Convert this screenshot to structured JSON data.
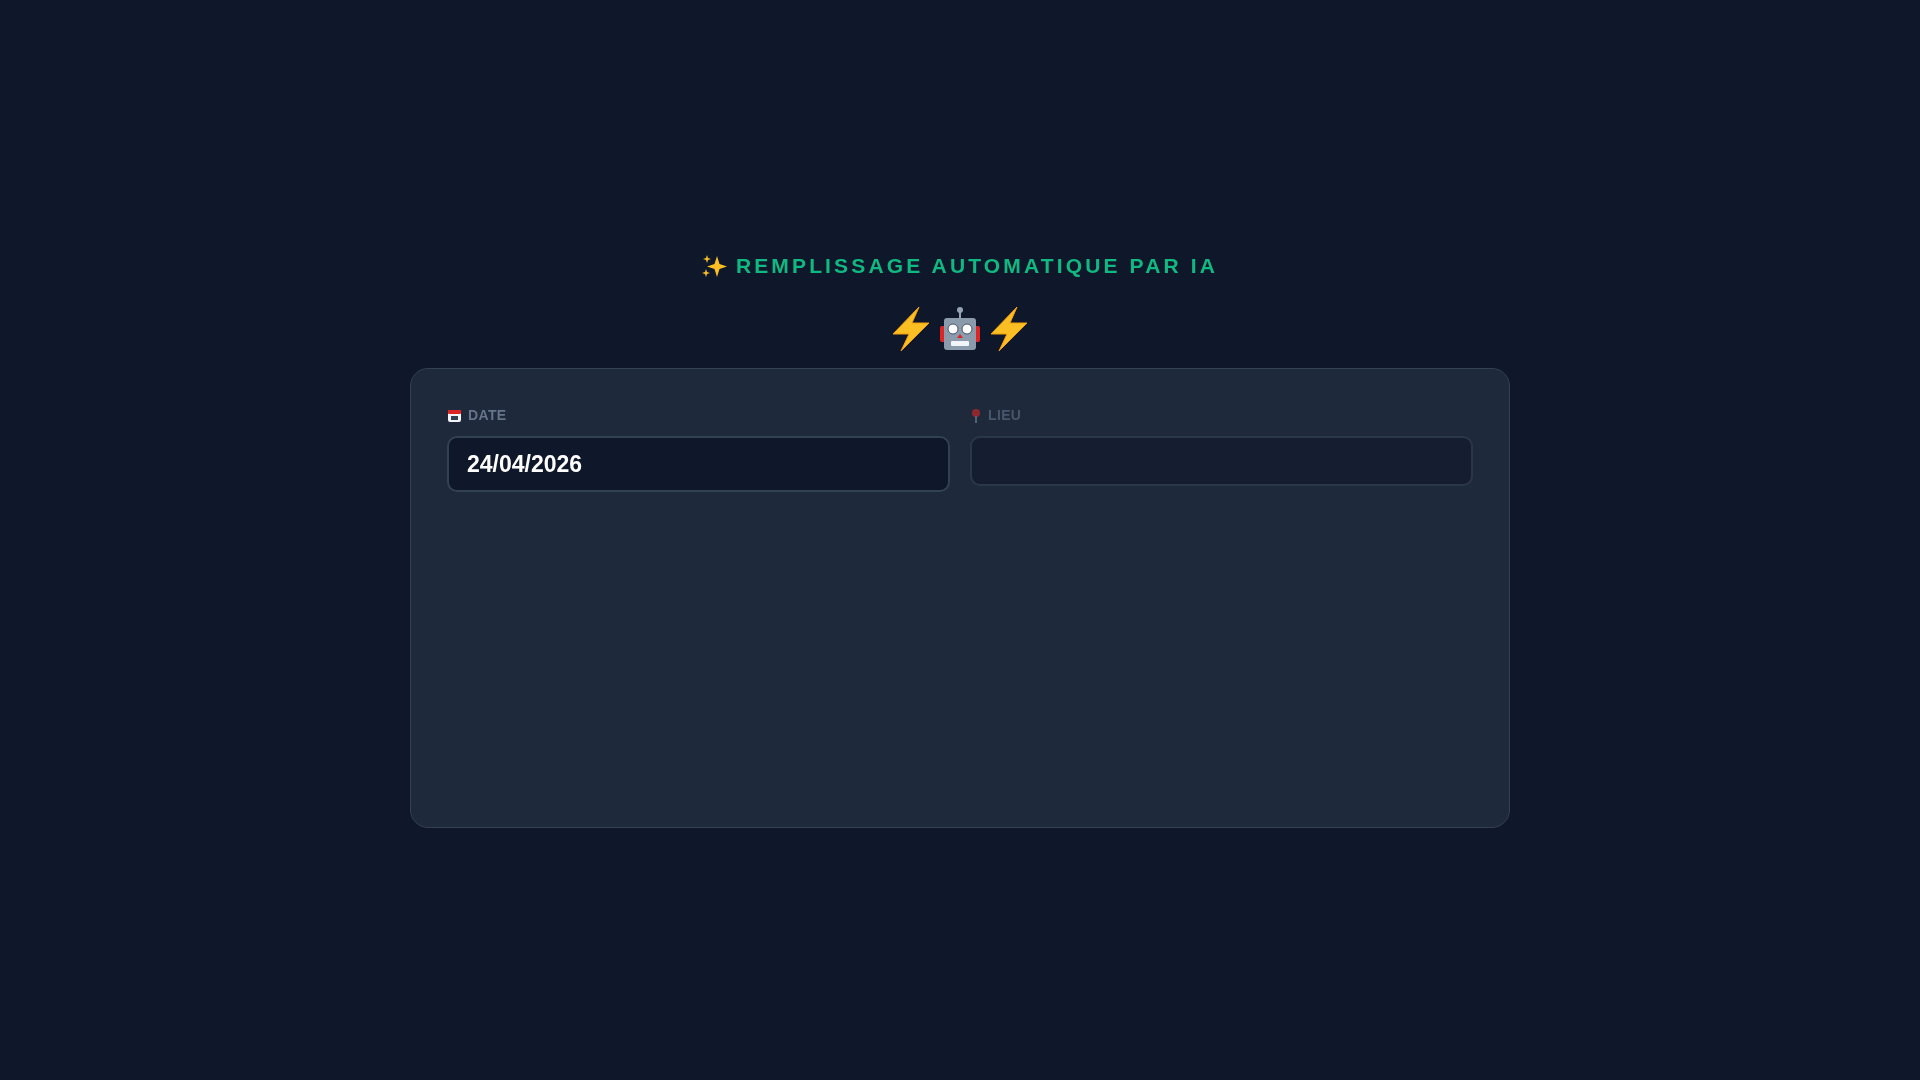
{
  "heading": {
    "title": "REMPLISSAGE AUTOMATIQUE PAR IA"
  },
  "fields": [
    {
      "label": "DATE",
      "value": "24/04/2026",
      "disabled": false
    },
    {
      "label": "LIEU",
      "disabled": true
    }
  ]
}
